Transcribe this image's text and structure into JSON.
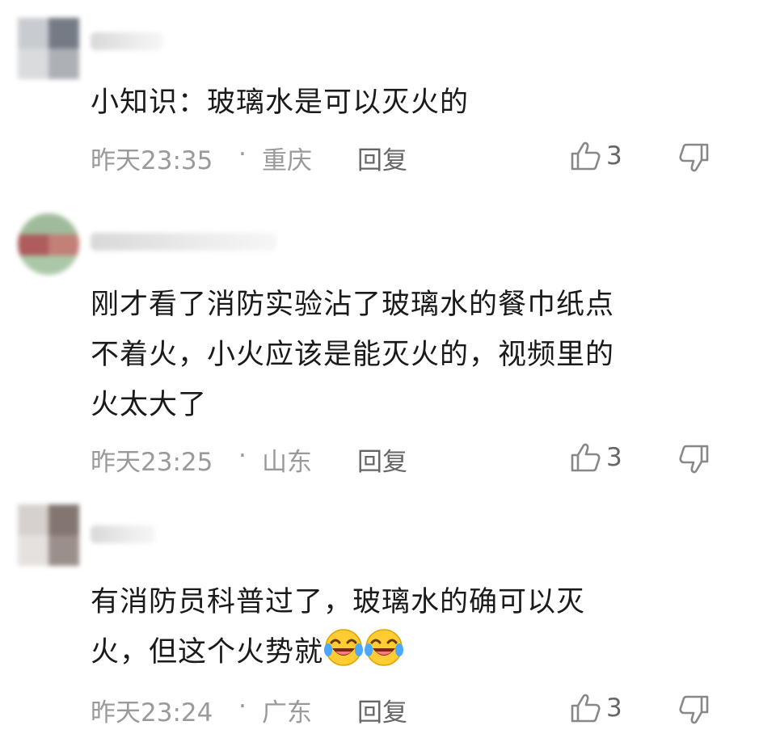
{
  "comments": [
    {
      "text_lines": [
        "小知识：玻璃水是可以灭火的"
      ],
      "time": "昨天23:35",
      "separator": "·",
      "location": "重庆",
      "reply_label": "回复",
      "likes": "3"
    },
    {
      "text_lines": [
        "刚才看了消防实验沾了玻璃水的餐巾纸点",
        "不着火，小火应该是能灭火的，视频里的",
        "火太大了"
      ],
      "time": "昨天23:25",
      "separator": "·",
      "location": "山东",
      "reply_label": "回复",
      "likes": "3"
    },
    {
      "text_lines": [
        "有消防员科普过了，玻璃水的确可以灭",
        "火，但这个火势就"
      ],
      "emoji": [
        "laughing-crying-emoji",
        "laughing-crying-emoji"
      ],
      "time": "昨天23:24",
      "separator": "·",
      "location": "广东",
      "reply_label": "回复",
      "likes": "3"
    }
  ],
  "icons": {
    "like": "thumbs-up-icon",
    "dislike": "thumbs-down-icon"
  },
  "colors": {
    "text": "#1a1a1a",
    "meta": "#9a9a9a",
    "action": "#666666"
  }
}
